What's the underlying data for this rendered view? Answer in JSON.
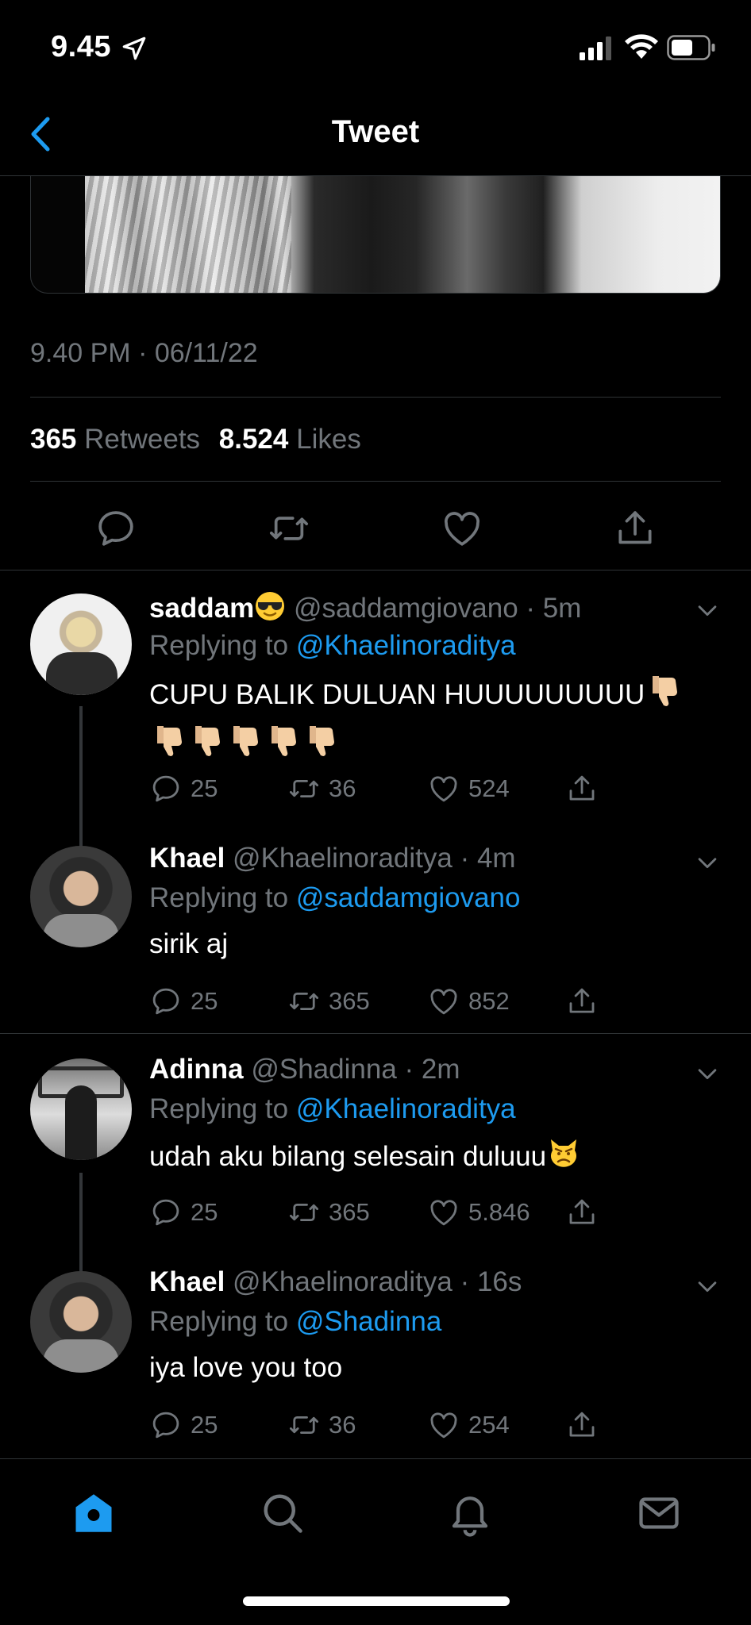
{
  "status_bar": {
    "time": "9.45"
  },
  "header": {
    "title": "Tweet"
  },
  "tweet": {
    "timestamp": "9.40 PM · 06/11/22",
    "retweets_count": "365",
    "retweets_label": "Retweets",
    "likes_count": "8.524",
    "likes_label": "Likes"
  },
  "replies": [
    {
      "name": "saddam",
      "name_emoji": "sunglasses-face-emoji",
      "handle": "@saddamgiovano",
      "time": "5m",
      "replying_label": "Replying to",
      "replying_to": "@Khaelinoraditya",
      "text": "CUPU BALIK DULUAN HUUUUUUUUU",
      "text_emoji": "thumbs-down-emoji x6",
      "comments": "25",
      "retweets": "36",
      "likes": "524"
    },
    {
      "name": "Khael",
      "handle": "@Khaelinoraditya",
      "time": "4m",
      "replying_label": "Replying to",
      "replying_to": "@saddamgiovano",
      "text": "sirik aj",
      "comments": "25",
      "retweets": "365",
      "likes": "852"
    },
    {
      "name": "Adinna",
      "handle": "@Shadinna",
      "time": "2m",
      "replying_label": "Replying to",
      "replying_to": "@Khaelinoraditya",
      "text": "udah aku bilang selesain duluuu",
      "text_emoji": "angry-cat-emoji",
      "comments": "25",
      "retweets": "365",
      "likes": "5.846"
    },
    {
      "name": "Khael",
      "handle": "@Khaelinoraditya",
      "time": "16s",
      "replying_label": "Replying to",
      "replying_to": "@Shadinna",
      "text": "iya love you too",
      "comments": "25",
      "retweets": "36",
      "likes": "254"
    }
  ],
  "colors": {
    "accent": "#1d9bf0",
    "muted": "#71767b",
    "background": "#000000",
    "divider": "#2f3336"
  },
  "tabbar": {
    "active": "home",
    "icons": [
      "home-icon",
      "search-icon",
      "notifications-icon",
      "messages-icon"
    ]
  }
}
